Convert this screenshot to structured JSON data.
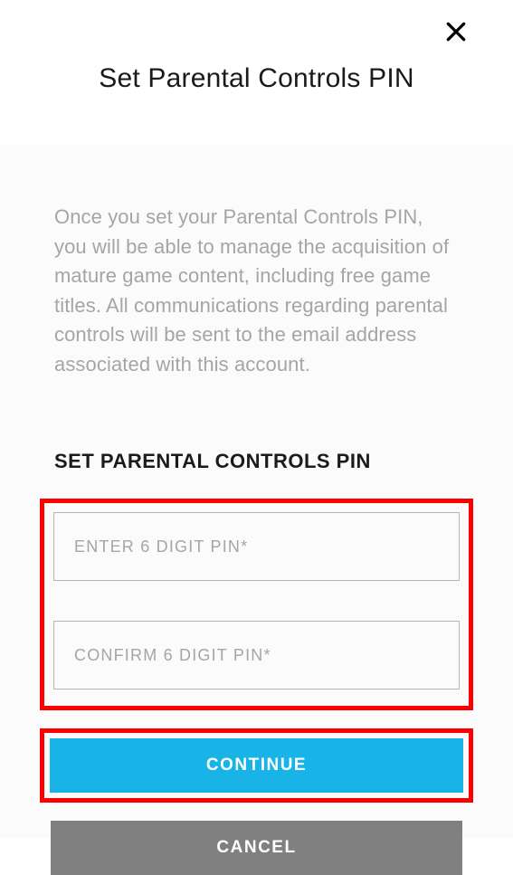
{
  "header": {
    "title": "Set Parental Controls PIN"
  },
  "content": {
    "description": "Once you set your Parental Controls PIN, you will be able to manage the acquisition of mature game content, including free game titles. All communications regarding parental controls will be sent to the email address associated with this account.",
    "section_heading": "SET PARENTAL CONTROLS PIN",
    "inputs": {
      "enter_pin_placeholder": "ENTER 6 DIGIT PIN*",
      "enter_pin_value": "",
      "confirm_pin_placeholder": "CONFIRM 6 DIGIT PIN*",
      "confirm_pin_value": ""
    },
    "buttons": {
      "continue_label": "CONTINUE",
      "cancel_label": "CANCEL"
    }
  }
}
